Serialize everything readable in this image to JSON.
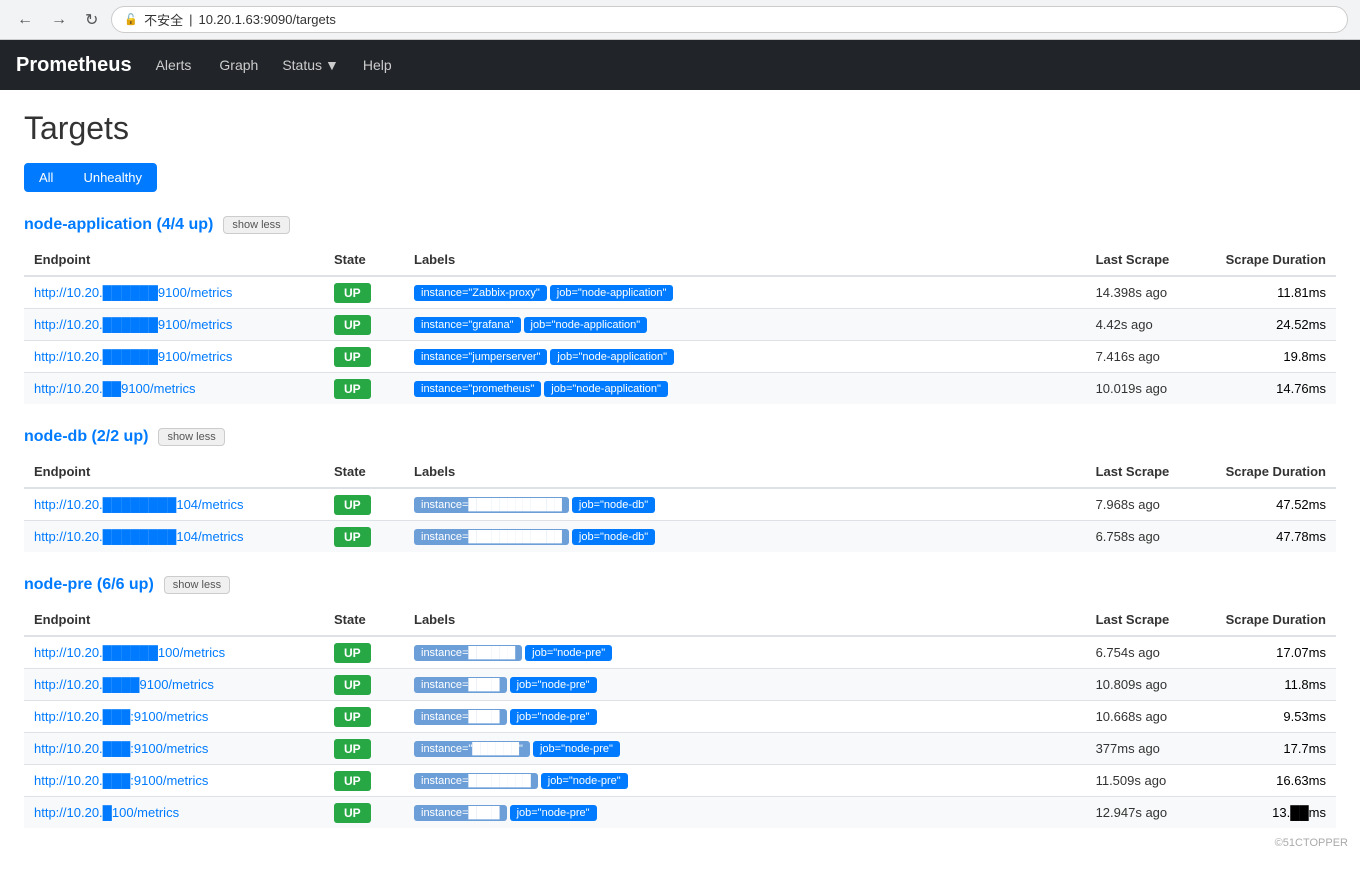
{
  "browser": {
    "url": "10.20.1.63:9090/targets",
    "full_url": "10.20.1.63:9090/targets",
    "security_label": "不安全"
  },
  "navbar": {
    "brand": "Prometheus",
    "links": [
      "Alerts",
      "Graph",
      "Status",
      "Help"
    ],
    "status_has_dropdown": true
  },
  "page": {
    "title": "Targets",
    "filter_all": "All",
    "filter_unhealthy": "Unhealthy"
  },
  "groups": [
    {
      "name": "node-application",
      "status": "4/4 up",
      "title": "node-application (4/4 up)",
      "show_less_label": "show less",
      "columns": [
        "Endpoint",
        "State",
        "Labels",
        "Last Scrape",
        "Scrape\nDuration"
      ],
      "rows": [
        {
          "endpoint": "http://10.20.██████9100/metrics",
          "state": "UP",
          "labels": [
            {
              "text": "instance=\"Zabbix-proxy\"",
              "blurred": false
            },
            {
              "text": "job=\"node-application\"",
              "blurred": false
            }
          ],
          "last_scrape": "14.398s ago",
          "scrape_duration": "11.81ms"
        },
        {
          "endpoint": "http://10.20.██████9100/metrics",
          "state": "UP",
          "labels": [
            {
              "text": "instance=\"grafana\"",
              "blurred": false
            },
            {
              "text": "job=\"node-application\"",
              "blurred": false
            }
          ],
          "last_scrape": "4.42s ago",
          "scrape_duration": "24.52ms"
        },
        {
          "endpoint": "http://10.20.██████9100/metrics",
          "state": "UP",
          "labels": [
            {
              "text": "instance=\"jumperserver\"",
              "blurred": false
            },
            {
              "text": "job=\"node-application\"",
              "blurred": false
            }
          ],
          "last_scrape": "7.416s ago",
          "scrape_duration": "19.8ms"
        },
        {
          "endpoint": "http://10.20.██9100/metrics",
          "state": "UP",
          "labels": [
            {
              "text": "instance=\"prometheus\"",
              "blurred": false
            },
            {
              "text": "job=\"node-application\"",
              "blurred": false
            }
          ],
          "last_scrape": "10.019s ago",
          "scrape_duration": "14.76ms"
        }
      ]
    },
    {
      "name": "node-db",
      "status": "2/2 up",
      "title": "node-db (2/2 up)",
      "show_less_label": "show less",
      "columns": [
        "Endpoint",
        "State",
        "Labels",
        "Last Scrape",
        "Scrape\nDuration"
      ],
      "rows": [
        {
          "endpoint": "http://10.20.████████104/metrics",
          "state": "UP",
          "labels": [
            {
              "text": "instance=████████████",
              "blurred": true
            },
            {
              "text": "job=\"node-db\"",
              "blurred": false
            }
          ],
          "last_scrape": "7.968s ago",
          "scrape_duration": "47.52ms"
        },
        {
          "endpoint": "http://10.20.████████104/metrics",
          "state": "UP",
          "labels": [
            {
              "text": "instance=████████████",
              "blurred": true
            },
            {
              "text": "job=\"node-db\"",
              "blurred": false
            }
          ],
          "last_scrape": "6.758s ago",
          "scrape_duration": "47.78ms"
        }
      ]
    },
    {
      "name": "node-pre",
      "status": "6/6 up",
      "title": "node-pre (6/6 up)",
      "show_less_label": "show less",
      "columns": [
        "Endpoint",
        "State",
        "Labels",
        "Last Scrape",
        "Scrape\nDuration"
      ],
      "rows": [
        {
          "endpoint": "http://10.20.██████100/metrics",
          "state": "UP",
          "labels": [
            {
              "text": "instance=██████",
              "blurred": true
            },
            {
              "text": "job=\"node-pre\"",
              "blurred": false
            }
          ],
          "last_scrape": "6.754s ago",
          "scrape_duration": "17.07ms"
        },
        {
          "endpoint": "http://10.20.████9100/metrics",
          "state": "UP",
          "labels": [
            {
              "text": "instance=████",
              "blurred": true
            },
            {
              "text": "job=\"node-pre\"",
              "blurred": false
            }
          ],
          "last_scrape": "10.809s ago",
          "scrape_duration": "11.8ms"
        },
        {
          "endpoint": "http://10.20.███:9100/metrics",
          "state": "UP",
          "labels": [
            {
              "text": "instance=████",
              "blurred": true
            },
            {
              "text": "job=\"node-pre\"",
              "blurred": false
            }
          ],
          "last_scrape": "10.668s ago",
          "scrape_duration": "9.53ms"
        },
        {
          "endpoint": "http://10.20.███:9100/metrics",
          "state": "UP",
          "labels": [
            {
              "text": "instance=\"██████\"",
              "blurred": true
            },
            {
              "text": "job=\"node-pre\"",
              "blurred": false
            }
          ],
          "last_scrape": "377ms ago",
          "scrape_duration": "17.7ms"
        },
        {
          "endpoint": "http://10.20.███:9100/metrics",
          "state": "UP",
          "labels": [
            {
              "text": "instance=████████",
              "blurred": true
            },
            {
              "text": "job=\"node-pre\"",
              "blurred": false
            }
          ],
          "last_scrape": "11.509s ago",
          "scrape_duration": "16.63ms"
        },
        {
          "endpoint": "http://10.20.█100/metrics",
          "state": "UP",
          "labels": [
            {
              "text": "instance=████",
              "blurred": true
            },
            {
              "text": "job=\"node-pre\"",
              "blurred": false
            }
          ],
          "last_scrape": "12.947s ago",
          "scrape_duration": "13.██ms"
        }
      ]
    }
  ],
  "watermark": "©51CTOPPER"
}
